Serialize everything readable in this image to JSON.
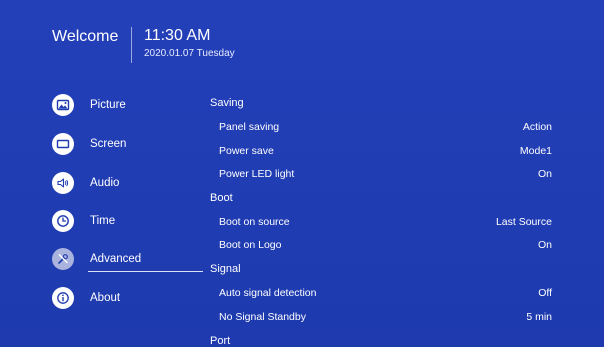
{
  "header": {
    "welcome": "Welcome",
    "time": "11:30 AM",
    "date": "2020.01.07 Tuesday"
  },
  "sidebar": {
    "items": [
      {
        "label": "Picture",
        "icon": "picture-icon"
      },
      {
        "label": "Screen",
        "icon": "screen-icon"
      },
      {
        "label": "Audio",
        "icon": "audio-icon"
      },
      {
        "label": "Time",
        "icon": "clock-icon"
      },
      {
        "label": "Advanced",
        "icon": "tools-icon",
        "selected": true
      },
      {
        "label": "About",
        "icon": "info-icon"
      }
    ]
  },
  "settings": {
    "saving": {
      "title": "Saving",
      "panel_saving": {
        "label": "Panel saving",
        "value": "Action"
      },
      "power_save": {
        "label": "Power save",
        "value": "Mode1"
      },
      "power_led": {
        "label": "Power LED light",
        "value": "On"
      }
    },
    "boot": {
      "title": "Boot",
      "boot_source": {
        "label": "Boot on source",
        "value": "Last Source"
      },
      "boot_logo": {
        "label": "Boot on Logo",
        "value": "On"
      }
    },
    "signal": {
      "title": "Signal",
      "auto_detect": {
        "label": "Auto signal detection",
        "value": "Off"
      },
      "no_signal_standby": {
        "label": "No Signal Standby",
        "value": "5 min"
      }
    },
    "port": {
      "title": "Port"
    }
  },
  "colors": {
    "background": "#1f3bb0",
    "text": "#ffffff",
    "icon_background": "#ffffff",
    "icon_glyph": "#1f3bb0",
    "selected_icon_background": "#a9b3de"
  }
}
